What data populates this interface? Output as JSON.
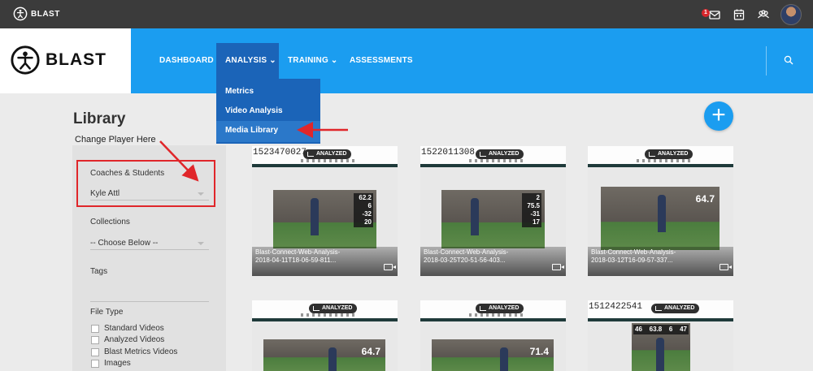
{
  "topbar": {
    "brand": "BLAST",
    "notification_count": "1"
  },
  "header": {
    "brand": "BLAST",
    "nav": {
      "dashboard": "DASHBOARD",
      "analysis": "ANALYSIS",
      "training": "TRAINING",
      "assessments": "ASSESSMENTS"
    }
  },
  "analysis_menu": {
    "items": [
      "Metrics",
      "Video Analysis",
      "Media Library"
    ],
    "active": "Media Library"
  },
  "page": {
    "title": "Library",
    "annotation": "Change Player Here"
  },
  "filters": {
    "coaches_label": "Coaches & Students",
    "coaches_value": "Kyle Attl",
    "collections_label": "Collections",
    "collections_value": "-- Choose Below --",
    "tags_label": "Tags",
    "file_type_label": "File Type",
    "file_types": [
      "Standard Videos",
      "Analyzed Videos",
      "Blast Metrics Videos",
      "Images"
    ]
  },
  "media": {
    "analyzed_label": "ANALYZED",
    "cards": [
      {
        "top_timestamp": "1523470027",
        "title_line1": "Blast-Connect-Web-Analysis-",
        "title_line2": "2018-04-11T18-06-59-811...",
        "stats": [
          "62.2",
          "6",
          "-32",
          "20"
        ],
        "big_metric": ""
      },
      {
        "top_timestamp": "1522011308",
        "title_line1": "Blast-Connect-Web-Analysis-",
        "title_line2": "2018-03-25T20-51-56-403...",
        "stats": [
          "2",
          "75.5",
          "-31",
          "17"
        ],
        "big_metric": ""
      },
      {
        "top_timestamp": "",
        "title_line1": "Blast-Connect-Web-Analysis-",
        "title_line2": "2018-03-12T16-09-57-337...",
        "stats": [],
        "big_metric": "64.7"
      },
      {
        "top_timestamp": "",
        "title_line1": "",
        "title_line2": "",
        "stats": [],
        "big_metric": "64.7"
      },
      {
        "top_timestamp": "",
        "title_line1": "",
        "title_line2": "",
        "stats": [],
        "big_metric": "71.4"
      },
      {
        "top_timestamp": "1512422541",
        "title_line1": "",
        "title_line2": "",
        "stats": [
          "46",
          "63.8",
          "6",
          "47"
        ],
        "big_metric": ""
      }
    ]
  },
  "colors": {
    "nav_blue": "#1b9df0",
    "menu_blue": "#1b64b8",
    "callout_red": "#e0262a",
    "topbar": "#3b3b3b"
  },
  "icons": {
    "topbar": [
      "inbox-icon",
      "calendar-icon",
      "team-icon",
      "avatar"
    ],
    "nav": [
      "search-icon"
    ],
    "action": [
      "plus-icon"
    ],
    "card": [
      "analyzed-chart-icon",
      "video-camera-icon"
    ]
  }
}
